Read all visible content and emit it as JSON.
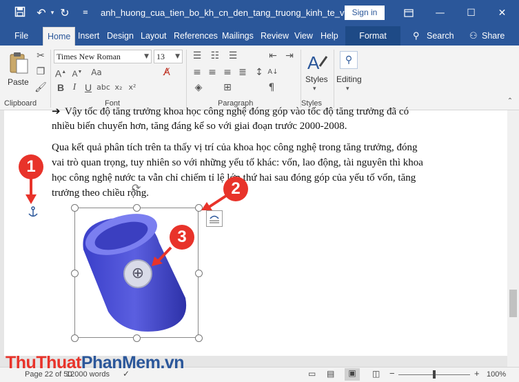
{
  "titlebar": {
    "doc_title": "anh_huong_cua_tien_bo_kh_cn_den_tang_truong_kinh_te_viet...",
    "signin": "Sign in"
  },
  "tabs": [
    {
      "label": "File"
    },
    {
      "label": "Home"
    },
    {
      "label": "Insert"
    },
    {
      "label": "Design"
    },
    {
      "label": "Layout"
    },
    {
      "label": "References"
    },
    {
      "label": "Mailings"
    },
    {
      "label": "Review"
    },
    {
      "label": "View"
    },
    {
      "label": "Help"
    },
    {
      "label": "Format"
    }
  ],
  "search": {
    "label": "Search"
  },
  "share": {
    "label": "Share"
  },
  "ribbon": {
    "paste": "Paste",
    "clipboard": "Clipboard",
    "font_name": "Times New Roman",
    "font_size": "13",
    "font_group": "Font",
    "paragraph_group": "Paragraph",
    "styles": "Styles",
    "styles_group": "Styles",
    "editing": "Editing"
  },
  "document": {
    "line1": "Vậy tốc độ tăng trưởng khoa học công nghệ đóng góp vào tốc độ tăng trưởng đã có",
    "line2": "nhiều biến chuyển hơn, tăng đáng kể so với giai đoạn trước 2000-2008.",
    "line3": "Qua kết quả phân tích trên ta thấy vị trí của khoa học công nghệ trong tăng trưởng, đóng",
    "line4": "vai trò quan trọng, tuy nhiên so với những yếu tố khác: vốn, lao động, tài nguyên thì khoa",
    "line5": "học công nghệ nước ta vẫn chỉ chiếm tỉ lệ lớn thứ hai sau đóng góp của yếu tố vốn, tăng",
    "line6": "trưởng theo chiều rộng."
  },
  "callouts": {
    "one": "1",
    "two": "2",
    "three": "3"
  },
  "status": {
    "page": "Page 22 of 50",
    "words": "12000 words",
    "zoom": "100%"
  },
  "watermark": {
    "part1": "ThuThuat",
    "part2": "PhanMem",
    "part3": ".vn"
  },
  "colors": {
    "accent": "#2b579a",
    "callout": "#e8332a",
    "shape": "#5b5fe0"
  }
}
